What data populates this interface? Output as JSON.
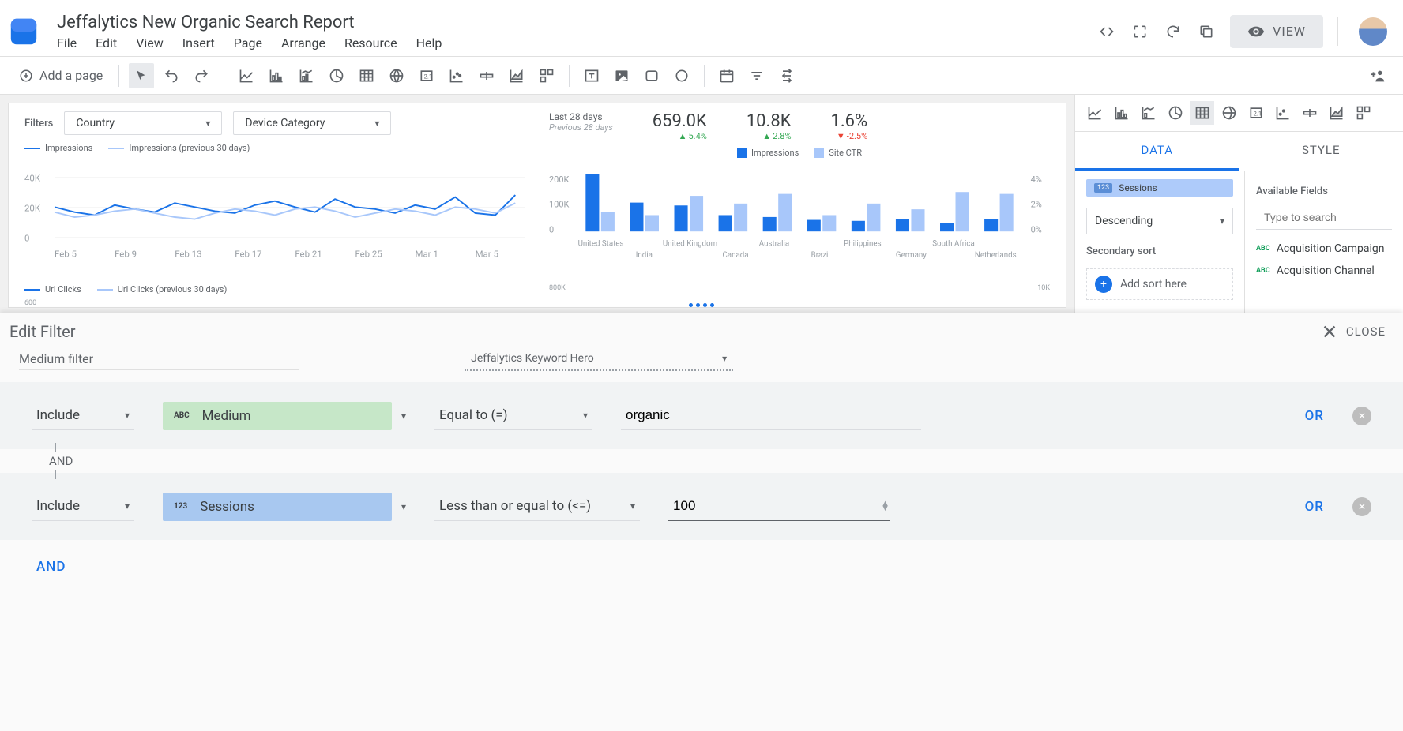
{
  "header": {
    "title": "Jeffalytics New Organic Search Report",
    "menu": [
      "File",
      "Edit",
      "View",
      "Insert",
      "Page",
      "Arrange",
      "Resource",
      "Help"
    ],
    "view_btn": "VIEW"
  },
  "toolbar": {
    "add_page": "Add a page"
  },
  "report": {
    "filters_label": "Filters",
    "filter_country": "Country",
    "filter_device": "Device Category",
    "legend_imp": "Impressions",
    "legend_imp_prev": "Impressions (previous 30 days)",
    "legend_clicks": "Url Clicks",
    "legend_clicks_prev": "Url Clicks (previous 30 days)",
    "y_ticks": [
      "40K",
      "20K",
      "0"
    ],
    "x_ticks": [
      "Feb 5",
      "Feb 9",
      "Feb 13",
      "Feb 17",
      "Feb 21",
      "Feb 25",
      "Mar 1",
      "Mar 5"
    ],
    "clicks_y": "600",
    "date_range": "Last 28 days",
    "date_prev": "Previous 28 days",
    "stats": [
      {
        "value": "659.0K",
        "delta": "5.4%",
        "dir": "up"
      },
      {
        "value": "10.8K",
        "delta": "2.8%",
        "dir": "up"
      },
      {
        "value": "1.6%",
        "delta": "-2.5%",
        "dir": "down"
      }
    ],
    "bar_legend_a": "Impressions",
    "bar_legend_b": "Site CTR",
    "bar_y_left": [
      "200K",
      "100K",
      "0"
    ],
    "bar_y_right": [
      "4%",
      "2%",
      "0%"
    ],
    "bar_y_right2": "10K",
    "bar_y_left2": "800K",
    "countries": [
      "United States",
      "India",
      "United Kingdom",
      "Canada",
      "Australia",
      "Brazil",
      "Philippines",
      "Germany",
      "South Africa",
      "Netherlands"
    ]
  },
  "sidebar": {
    "tab_data": "DATA",
    "tab_style": "STYLE",
    "sessions_chip": "Sessions",
    "sort_value": "Descending",
    "secondary_sort": "Secondary sort",
    "add_sort": "Add sort here",
    "available_fields": "Available Fields",
    "search_placeholder": "Type to search",
    "fields": [
      "Acquisition Campaign",
      "Acquisition Channel"
    ]
  },
  "filter_panel": {
    "title": "Edit Filter",
    "close": "CLOSE",
    "name": "Medium filter",
    "source": "Jeffalytics Keyword Hero",
    "rows": [
      {
        "action": "Include",
        "field": "Medium",
        "field_type": "ABC",
        "chip_class": "chip-green",
        "condition": "Equal to (=)",
        "value": "organic"
      },
      {
        "action": "Include",
        "field": "Sessions",
        "field_type": "123",
        "chip_class": "chip-blue",
        "condition": "Less than or equal to (<=)",
        "value": "100"
      }
    ],
    "and": "AND",
    "or": "OR",
    "and_add": "AND"
  },
  "chart_data": [
    {
      "type": "line",
      "title": "Impressions",
      "x": [
        "Feb 5",
        "Feb 9",
        "Feb 13",
        "Feb 17",
        "Feb 21",
        "Feb 25",
        "Mar 1",
        "Mar 5"
      ],
      "series": [
        {
          "name": "Impressions",
          "values": [
            24000,
            22000,
            21000,
            25000,
            23000,
            22000,
            26000,
            24000,
            23000,
            22000,
            25000,
            27000,
            24000,
            22000,
            28000,
            24000,
            23000,
            22000,
            25000,
            23000,
            28000,
            22000,
            21000,
            23000,
            25000,
            27000,
            22000,
            30000,
            26000
          ]
        },
        {
          "name": "Impressions (previous 30 days)",
          "values": [
            22000,
            20000,
            21000,
            23000,
            24000,
            22000,
            20000,
            19000,
            22000,
            24000,
            23000,
            21000,
            24000,
            25000,
            23000,
            20000,
            22000,
            24000,
            23000,
            21000,
            25000,
            24000,
            22000,
            21000,
            24000,
            23000,
            21000,
            26000,
            23000
          ]
        }
      ],
      "ylim": [
        0,
        40000
      ]
    },
    {
      "type": "bar",
      "categories": [
        "United States",
        "India",
        "United Kingdom",
        "Canada",
        "Australia",
        "Brazil",
        "Philippines",
        "Germany",
        "South Africa",
        "Netherlands"
      ],
      "series": [
        {
          "name": "Impressions",
          "values": [
            210000,
            90000,
            80000,
            55000,
            50000,
            40000,
            38000,
            42000,
            30000,
            40000
          ]
        },
        {
          "name": "Site CTR",
          "values": [
            0.016,
            0.012,
            0.025,
            0.02,
            0.028,
            0.012,
            0.022,
            0.018,
            0.03,
            0.028
          ]
        }
      ],
      "ylim_left": [
        0,
        200000
      ],
      "ylim_right": [
        0,
        0.04
      ]
    }
  ]
}
